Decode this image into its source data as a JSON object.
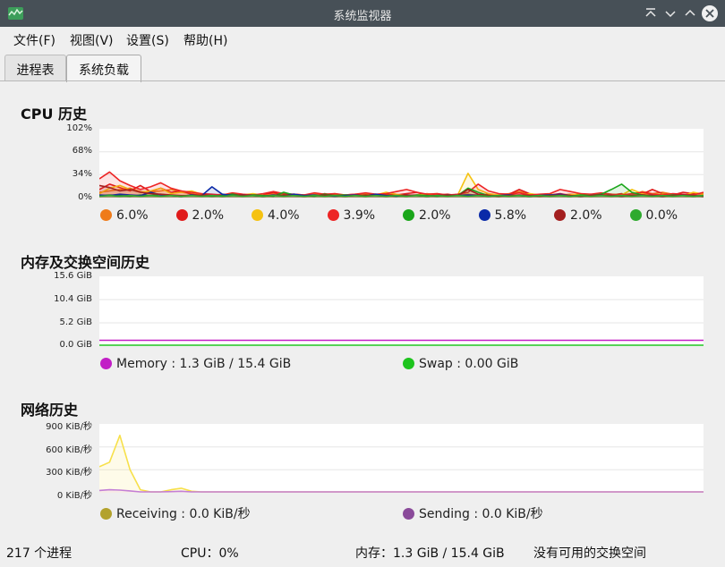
{
  "window": {
    "title": "系统监视器"
  },
  "menu": [
    "文件(F)",
    "视图(V)",
    "设置(S)",
    "帮助(H)"
  ],
  "tabs": [
    "进程表",
    "系统负载"
  ],
  "active_tab": 1,
  "cpu": {
    "title": "CPU 历史",
    "yticks": [
      "102%",
      "68%",
      "34%",
      "0%"
    ],
    "legend": [
      {
        "value": "6.0%",
        "color": "#ef7b1a"
      },
      {
        "value": "2.0%",
        "color": "#e01b1b"
      },
      {
        "value": "4.0%",
        "color": "#f5c211"
      },
      {
        "value": "3.9%",
        "color": "#ed2424"
      },
      {
        "value": "2.0%",
        "color": "#1aa61a"
      },
      {
        "value": "5.8%",
        "color": "#0a2aa8"
      },
      {
        "value": "2.0%",
        "color": "#a31f1f"
      },
      {
        "value": "0.0%",
        "color": "#2eaa2e"
      }
    ]
  },
  "memory": {
    "title": "内存及交换空间历史",
    "yticks": [
      "15.6 GiB",
      "10.4 GiB",
      "5.2 GiB",
      "0.0 GiB"
    ],
    "legend": [
      {
        "label": "Memory : 1.3 GiB / 15.4 GiB",
        "color": "#c21ec6"
      },
      {
        "label": "Swap : 0.00 GiB",
        "color": "#1ec41e"
      }
    ]
  },
  "network": {
    "title": "网络历史",
    "yticks": [
      "900 KiB/秒",
      "600 KiB/秒",
      "300 KiB/秒",
      "0 KiB/秒"
    ],
    "legend": [
      {
        "label": "Receiving : 0.0 KiB/秒",
        "color": "#b3a22c"
      },
      {
        "label": "Sending : 0.0 KiB/秒",
        "color": "#8a4a9a"
      }
    ]
  },
  "status": {
    "processes": "217 个进程",
    "cpu": "CPU：0%",
    "memory": "内存：1.3 GiB / 15.4 GiB",
    "swap": "没有可用的交换空间"
  },
  "chart_data": [
    {
      "type": "line",
      "title": "CPU 历史",
      "ylim": [
        0,
        102
      ],
      "ylabel": "",
      "x": [
        0,
        1,
        2,
        3,
        4,
        5,
        6,
        7,
        8,
        9,
        10,
        11,
        12,
        13,
        14,
        15,
        16,
        17,
        18,
        19,
        20,
        21,
        22,
        23,
        24,
        25,
        26,
        27,
        28,
        29,
        30,
        31,
        32,
        33,
        34,
        35,
        36,
        37,
        38,
        39,
        40,
        41,
        42,
        43,
        44,
        45,
        46,
        47,
        48,
        49,
        50,
        51,
        52,
        53,
        54,
        55,
        56,
        57,
        58,
        59
      ],
      "series": [
        {
          "name": "6.0%",
          "color": "#ef7b1a",
          "values": [
            8,
            10,
            12,
            14,
            9,
            8,
            10,
            12,
            8,
            6,
            4,
            3,
            5,
            4,
            3,
            4,
            3,
            6,
            4,
            3,
            4,
            3,
            4,
            5,
            3,
            3,
            4,
            5,
            3,
            4,
            3,
            4,
            6,
            4,
            3,
            4,
            5,
            3,
            3,
            4,
            6,
            9,
            5,
            4,
            3,
            4,
            5,
            4,
            3,
            4,
            5,
            3,
            4,
            9,
            6,
            8,
            5,
            4,
            5,
            6
          ]
        },
        {
          "name": "2.0%",
          "color": "#e01b1b",
          "values": [
            12,
            20,
            15,
            10,
            18,
            9,
            14,
            8,
            10,
            5,
            3,
            4,
            3,
            6,
            4,
            3,
            4,
            8,
            3,
            5,
            4,
            3,
            6,
            3,
            4,
            5,
            4,
            3,
            5,
            4,
            6,
            8,
            3,
            4,
            5,
            3,
            4,
            4,
            5,
            3,
            5,
            12,
            6,
            3,
            4,
            6,
            3,
            4,
            5,
            3,
            4,
            6,
            3,
            5,
            12,
            6,
            4,
            8,
            6,
            5
          ]
        },
        {
          "name": "4.0%",
          "color": "#f5c211",
          "values": [
            6,
            14,
            18,
            12,
            8,
            10,
            14,
            6,
            8,
            10,
            5,
            3,
            4,
            5,
            4,
            6,
            3,
            4,
            5,
            4,
            3,
            5,
            4,
            6,
            3,
            4,
            5,
            4,
            8,
            5,
            3,
            4,
            5,
            6,
            3,
            4,
            36,
            12,
            6,
            4,
            5,
            3,
            6,
            4,
            5,
            3,
            4,
            6,
            4,
            3,
            5,
            4,
            12,
            6,
            4,
            5,
            4,
            3,
            8,
            5
          ]
        },
        {
          "name": "3.9%",
          "color": "#ed2424",
          "values": [
            28,
            38,
            25,
            18,
            12,
            16,
            22,
            14,
            10,
            8,
            6,
            5,
            4,
            7,
            5,
            4,
            6,
            9,
            6,
            5,
            4,
            7,
            5,
            6,
            4,
            5,
            7,
            5,
            6,
            9,
            12,
            8,
            5,
            6,
            4,
            5,
            8,
            20,
            10,
            6,
            5,
            7,
            4,
            5,
            6,
            12,
            9,
            6,
            5,
            7,
            5,
            4,
            6,
            8,
            5,
            4,
            6,
            5,
            4,
            8
          ]
        },
        {
          "name": "2.0%",
          "color": "#1aa61a",
          "values": [
            3,
            4,
            3,
            2,
            4,
            3,
            5,
            3,
            2,
            4,
            3,
            2,
            3,
            5,
            3,
            4,
            3,
            2,
            8,
            4,
            3,
            2,
            5,
            3,
            4,
            3,
            2,
            4,
            3,
            3,
            2,
            4,
            3,
            2,
            4,
            3,
            14,
            8,
            3,
            2,
            4,
            3,
            2,
            3,
            4,
            3,
            2,
            4,
            3,
            5,
            12,
            20,
            8,
            4,
            3,
            2,
            4,
            3,
            2,
            3
          ]
        },
        {
          "name": "5.8%",
          "color": "#0a2aa8",
          "values": [
            4,
            3,
            5,
            4,
            3,
            8,
            4,
            3,
            2,
            4,
            3,
            16,
            5,
            3,
            4,
            3,
            2,
            4,
            3,
            5,
            3,
            4,
            3,
            2,
            3,
            4,
            3,
            5,
            3,
            2,
            4,
            3,
            2,
            3,
            4,
            3,
            4,
            3,
            2,
            3,
            4,
            3,
            2,
            3,
            4,
            5,
            3,
            2,
            3,
            4,
            3,
            2,
            3,
            4,
            3,
            2,
            3,
            4,
            3,
            2
          ]
        },
        {
          "name": "2.0%",
          "color": "#a31f1f",
          "values": [
            18,
            15,
            10,
            12,
            8,
            6,
            5,
            4,
            3,
            3,
            4,
            3,
            2,
            3,
            4,
            3,
            2,
            3,
            4,
            3,
            2,
            3,
            4,
            3,
            2,
            3,
            4,
            3,
            2,
            3,
            4,
            3,
            2,
            3,
            4,
            3,
            12,
            5,
            3,
            2,
            3,
            4,
            3,
            2,
            3,
            4,
            3,
            2,
            3,
            4,
            3,
            2,
            3,
            4,
            3,
            2,
            3,
            4,
            3,
            2
          ]
        },
        {
          "name": "0.0%",
          "color": "#2eaa2e",
          "values": [
            2,
            3,
            2,
            3,
            2,
            3,
            2,
            3,
            2,
            3,
            2,
            3,
            2,
            3,
            2,
            3,
            2,
            3,
            2,
            3,
            2,
            3,
            2,
            3,
            2,
            3,
            2,
            3,
            2,
            3,
            2,
            3,
            2,
            3,
            2,
            3,
            2,
            3,
            2,
            3,
            2,
            3,
            2,
            3,
            2,
            3,
            2,
            3,
            2,
            3,
            2,
            3,
            2,
            3,
            2,
            3,
            2,
            3,
            2,
            3
          ]
        }
      ]
    },
    {
      "type": "line",
      "title": "内存及交换空间历史",
      "ylim": [
        0,
        15.6
      ],
      "x": [
        0,
        1
      ],
      "series": [
        {
          "name": "Memory : 1.3 GiB / 15.4 GiB",
          "color": "#c21ec6",
          "values": [
            1.3,
            1.3
          ]
        },
        {
          "name": "Swap : 0.00 GiB",
          "color": "#1ec41e",
          "values": [
            0.0,
            0.0
          ]
        }
      ]
    },
    {
      "type": "area",
      "title": "网络历史",
      "ylim": [
        0,
        900
      ],
      "x": [
        0,
        1,
        2,
        3,
        4,
        5,
        6,
        7,
        8,
        9,
        10,
        11,
        12,
        13,
        14,
        15,
        16,
        17,
        18,
        19,
        20,
        21,
        22,
        23,
        24,
        25,
        26,
        27,
        28,
        29,
        30,
        31,
        32,
        33,
        34,
        35,
        36,
        37,
        38,
        39,
        40,
        41,
        42,
        43,
        44,
        45,
        46,
        47,
        48,
        49,
        50,
        51,
        52,
        53,
        54,
        55,
        56,
        57,
        58,
        59
      ],
      "series": [
        {
          "name": "Receiving : 0.0 KiB/秒",
          "color": "#f7e04a",
          "values": [
            340,
            400,
            750,
            300,
            40,
            10,
            5,
            40,
            60,
            20,
            5,
            0,
            0,
            0,
            0,
            0,
            0,
            0,
            0,
            0,
            0,
            0,
            0,
            0,
            0,
            0,
            0,
            0,
            0,
            0,
            0,
            0,
            0,
            0,
            0,
            0,
            0,
            0,
            0,
            0,
            0,
            0,
            0,
            0,
            0,
            0,
            0,
            0,
            0,
            0,
            0,
            0,
            0,
            0,
            0,
            0,
            0,
            0,
            0,
            0
          ]
        },
        {
          "name": "Sending : 0.0 KiB/秒",
          "color": "#c37fd6",
          "values": [
            30,
            40,
            35,
            25,
            10,
            5,
            5,
            15,
            20,
            10,
            5,
            0,
            0,
            0,
            0,
            0,
            0,
            0,
            0,
            0,
            0,
            0,
            0,
            0,
            0,
            0,
            0,
            0,
            0,
            0,
            0,
            0,
            0,
            0,
            0,
            0,
            0,
            0,
            0,
            0,
            0,
            0,
            0,
            0,
            0,
            0,
            0,
            0,
            0,
            0,
            0,
            0,
            0,
            0,
            0,
            0,
            0,
            0,
            0,
            0
          ]
        }
      ]
    }
  ]
}
